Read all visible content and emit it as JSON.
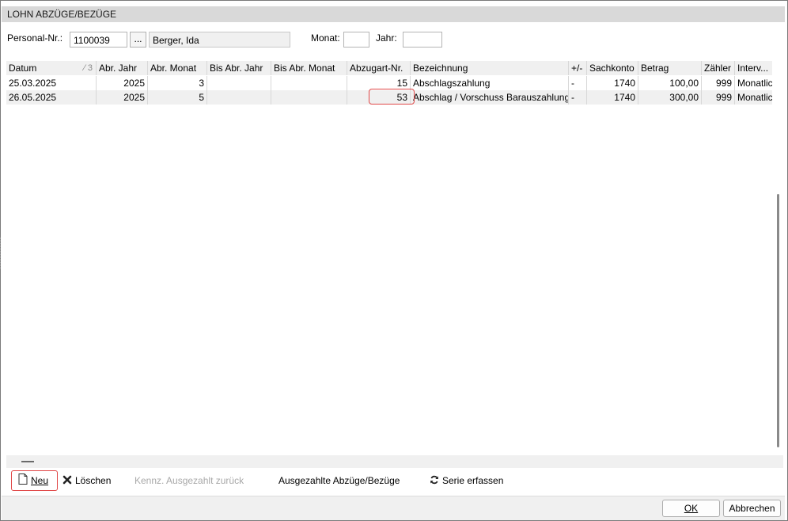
{
  "window": {
    "title": "LOHN ABZÜGE/BEZÜGE"
  },
  "header": {
    "personal_nr_label": "Personal-Nr.:",
    "personal_nr_value": "1100039",
    "lookup_button": "...",
    "name_value": "Berger, Ida",
    "monat_label": "Monat:",
    "monat_value": "",
    "jahr_label": "Jahr:",
    "jahr_value": ""
  },
  "grid": {
    "columns": [
      "Datum",
      "Abr. Jahr",
      "Abr. Monat",
      "Bis Abr. Jahr",
      "Bis Abr. Monat",
      "Abzugart-Nr.",
      "Bezeichnung",
      "+/-",
      "Sachkonto",
      "Betrag",
      "Zähler",
      "Interv..."
    ],
    "sort_indicator": "⁄ 3",
    "rows": [
      [
        "25.03.2025",
        "2025",
        "3",
        "",
        "",
        "15",
        "Abschlagszahlung",
        "-",
        "1740",
        "100,00",
        "999",
        "Monatlich"
      ],
      [
        "26.05.2025",
        "2025",
        "5",
        "",
        "",
        "53",
        "Abschlag / Vorschuss Barauszahlung",
        "-",
        "1740",
        "300,00",
        "999",
        "Monatlich"
      ]
    ]
  },
  "toolbar": {
    "neu": "Neu",
    "loeschen": "Löschen",
    "kennz": "Kennz. Ausgezahlt zurück",
    "ausgezahlte": "Ausgezahlte Abzüge/Bezüge",
    "serie": "Serie erfassen"
  },
  "dialog": {
    "ok": "OK",
    "abbrechen": "Abbrechen"
  }
}
